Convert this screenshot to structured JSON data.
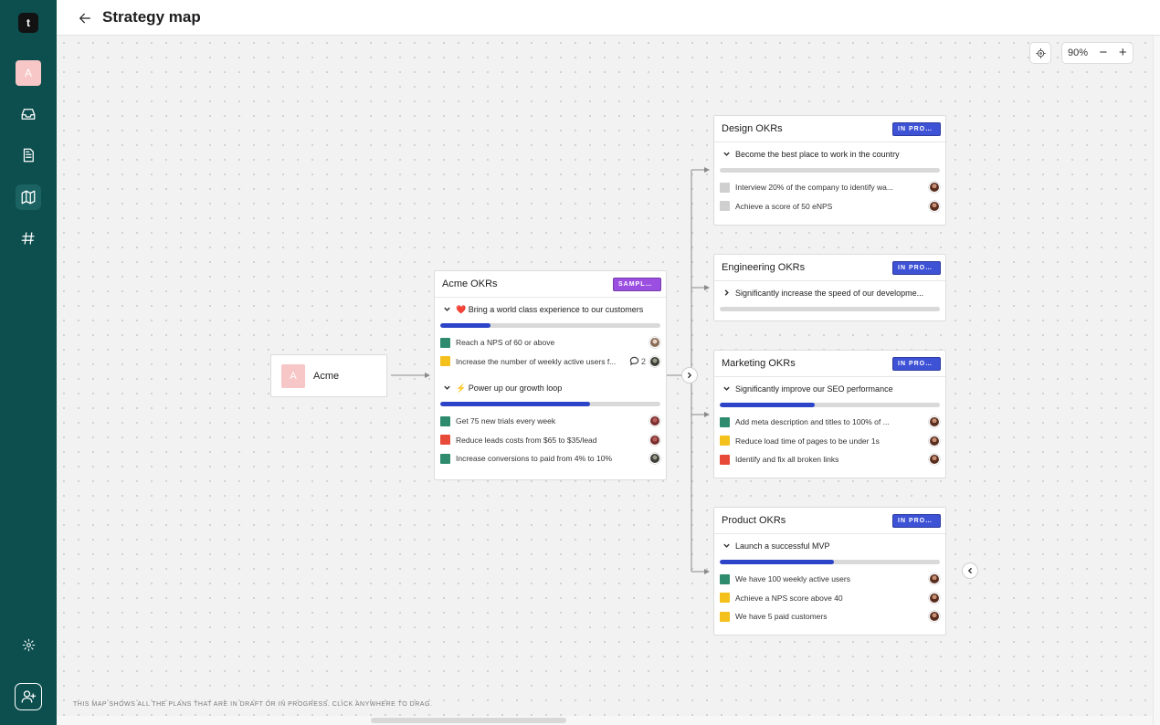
{
  "header": {
    "title": "Strategy map",
    "back_icon": "arrow-left-icon"
  },
  "sidebar": {
    "logo": "t",
    "workspace_initial": "A",
    "items": [
      {
        "name": "inbox",
        "icon": "inbox-icon"
      },
      {
        "name": "documents",
        "icon": "document-icon"
      },
      {
        "name": "strategy-map",
        "icon": "map-icon",
        "active": true
      },
      {
        "name": "channels",
        "icon": "hash-icon"
      }
    ],
    "settings_icon": "gear-icon",
    "invite_icon": "add-user-icon"
  },
  "toolbar": {
    "zoom": "90%",
    "zoom_out": "−",
    "zoom_in": "+",
    "locate_icon": "crosshair-icon"
  },
  "footer_note": "This map shows all the plans that are in draft or in progress. Click anywhere to drag.",
  "colors": {
    "sidebar": "#0d4f4f",
    "badge_progress": "#3d52d5",
    "badge_sample": "#9b4fe0",
    "progress_fill": "#2c45c8",
    "status_green": "#2e8b6e",
    "status_yellow": "#f3c01c",
    "status_red": "#e84a3a",
    "status_gray": "#cfcfcf"
  },
  "root": {
    "initial": "A",
    "label": "Acme"
  },
  "acme_card": {
    "title": "Acme OKRs",
    "badge": "SAMPLE ...",
    "objectives": [
      {
        "title": "❤️ Bring a world class experience to our customers",
        "progress": 0.23,
        "key_results": [
          {
            "text": "Reach a NPS of 60 or above",
            "status": "green"
          },
          {
            "text": "Increase the number of weekly active users f...",
            "status": "yellow",
            "comments": "2"
          }
        ]
      },
      {
        "title": "⚡ Power up our growth loop",
        "progress": 0.68,
        "key_results": [
          {
            "text": "Get 75 new trials every week",
            "status": "green"
          },
          {
            "text": "Reduce leads costs from $65 to $35/lead",
            "status": "red"
          },
          {
            "text": "Increase conversions to paid from 4% to 10%",
            "status": "green"
          }
        ]
      }
    ]
  },
  "design_card": {
    "title": "Design OKRs",
    "badge": "IN PROG...",
    "objective": "Become the best place to work in the country",
    "progress": 0,
    "key_results": [
      {
        "text": "Interview 20% of the company to identify wa...",
        "status": "gray"
      },
      {
        "text": "Achieve a score of 50 eNPS",
        "status": "gray"
      }
    ]
  },
  "engineering_card": {
    "title": "Engineering OKRs",
    "badge": "IN PROG...",
    "objective": "Significantly increase the speed of our developme...",
    "progress": 0
  },
  "marketing_card": {
    "title": "Marketing OKRs",
    "badge": "IN PROG...",
    "objective": "Significantly improve our SEO performance",
    "progress": 0.43,
    "key_results": [
      {
        "text": "Add meta description and titles to 100% of ...",
        "status": "green"
      },
      {
        "text": "Reduce load time of pages to be under 1s",
        "status": "yellow"
      },
      {
        "text": "Identify and fix all broken links",
        "status": "red"
      }
    ]
  },
  "product_card": {
    "title": "Product OKRs",
    "badge": "IN PROG...",
    "objective": "Launch a successful MVP",
    "progress": 0.52,
    "key_results": [
      {
        "text": "We have 100 weekly active users",
        "status": "green"
      },
      {
        "text": "Achieve a NPS score above 40",
        "status": "yellow"
      },
      {
        "text": "We have 5 paid customers",
        "status": "yellow"
      }
    ]
  }
}
